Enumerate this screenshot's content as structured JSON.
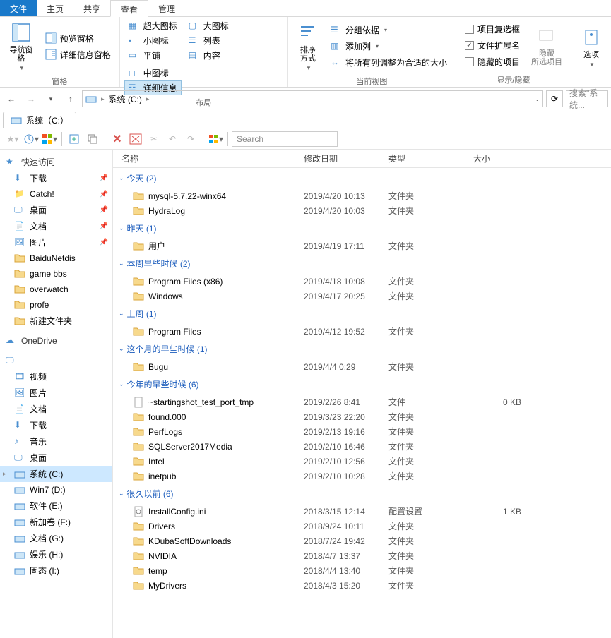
{
  "ribbon": {
    "tabs": [
      "文件",
      "主页",
      "共享",
      "查看",
      "管理"
    ],
    "groups": {
      "panes": {
        "nav": "导航窗格",
        "preview": "预览窗格",
        "details": "详细信息窗格",
        "label": "窗格"
      },
      "layout": {
        "items": [
          "超大图标",
          "大图标",
          "中图标",
          "小图标",
          "列表",
          "详细信息",
          "平铺",
          "内容"
        ],
        "label": "布局"
      },
      "view": {
        "sort": "排序方式",
        "group": "分组依据",
        "addcol": "添加列",
        "fitcols": "将所有列调整为合适的大小",
        "label": "当前视图"
      },
      "showhide": {
        "checkboxes": "项目复选框",
        "ext": "文件扩展名",
        "hidden": "隐藏的项目",
        "hideitems": "隐藏\n所选项目",
        "label": "显示/隐藏"
      },
      "options": "选项"
    }
  },
  "address": {
    "crumb": "系统 (C:)",
    "search_placeholder": "搜索\"系统..."
  },
  "doctab": "系统（C:）",
  "toolbar_search": "Search",
  "columns": {
    "name": "名称",
    "date": "修改日期",
    "type": "类型",
    "size": "大小"
  },
  "nav": {
    "quick": {
      "label": "快速访问",
      "items": [
        "下载",
        "Catch!",
        "桌面",
        "文档",
        "图片"
      ]
    },
    "loose": [
      "BaiduNetdis",
      "game bbs",
      "overwatch",
      "profe",
      "新建文件夹"
    ],
    "onedrive": "OneDrive",
    "thispc": {
      "items": [
        "视频",
        "图片",
        "文档",
        "下载",
        "音乐",
        "桌面"
      ]
    },
    "drives": [
      "系统 (C:)",
      "Win7 (D:)",
      "软件 (E:)",
      "新加卷 (F:)",
      "文档 (G:)",
      "娱乐 (H:)",
      "固态 (I:)"
    ]
  },
  "groups": [
    {
      "label": "今天 (2)",
      "items": [
        {
          "icon": "folder",
          "name": "mysql-5.7.22-winx64",
          "date": "2019/4/20 10:13",
          "type": "文件夹",
          "size": ""
        },
        {
          "icon": "folder",
          "name": "HydraLog",
          "date": "2019/4/20 10:03",
          "type": "文件夹",
          "size": ""
        }
      ]
    },
    {
      "label": "昨天 (1)",
      "items": [
        {
          "icon": "folder",
          "name": "用户",
          "date": "2019/4/19 17:11",
          "type": "文件夹",
          "size": ""
        }
      ]
    },
    {
      "label": "本周早些时候 (2)",
      "items": [
        {
          "icon": "folder",
          "name": "Program Files (x86)",
          "date": "2019/4/18 10:08",
          "type": "文件夹",
          "size": ""
        },
        {
          "icon": "folder",
          "name": "Windows",
          "date": "2019/4/17 20:25",
          "type": "文件夹",
          "size": ""
        }
      ]
    },
    {
      "label": "上周 (1)",
      "items": [
        {
          "icon": "folder",
          "name": "Program Files",
          "date": "2019/4/12 19:52",
          "type": "文件夹",
          "size": ""
        }
      ]
    },
    {
      "label": "这个月的早些时候 (1)",
      "items": [
        {
          "icon": "folder",
          "name": "Bugu",
          "date": "2019/4/4 0:29",
          "type": "文件夹",
          "size": ""
        }
      ]
    },
    {
      "label": "今年的早些时候 (6)",
      "items": [
        {
          "icon": "file",
          "name": "~startingshot_test_port_tmp",
          "date": "2019/2/26 8:41",
          "type": "文件",
          "size": "0 KB"
        },
        {
          "icon": "folder",
          "name": "found.000",
          "date": "2019/3/23 22:20",
          "type": "文件夹",
          "size": ""
        },
        {
          "icon": "folder",
          "name": "PerfLogs",
          "date": "2019/2/13 19:16",
          "type": "文件夹",
          "size": ""
        },
        {
          "icon": "folder",
          "name": "SQLServer2017Media",
          "date": "2019/2/10 16:46",
          "type": "文件夹",
          "size": ""
        },
        {
          "icon": "folder",
          "name": "Intel",
          "date": "2019/2/10 12:56",
          "type": "文件夹",
          "size": ""
        },
        {
          "icon": "folder",
          "name": "inetpub",
          "date": "2019/2/10 10:28",
          "type": "文件夹",
          "size": ""
        }
      ]
    },
    {
      "label": "很久以前 (6)",
      "items": [
        {
          "icon": "ini",
          "name": "InstallConfig.ini",
          "date": "2018/3/15 12:14",
          "type": "配置设置",
          "size": "1 KB"
        },
        {
          "icon": "folder",
          "name": "Drivers",
          "date": "2018/9/24 10:11",
          "type": "文件夹",
          "size": ""
        },
        {
          "icon": "folder",
          "name": "KDubaSoftDownloads",
          "date": "2018/7/24 19:42",
          "type": "文件夹",
          "size": ""
        },
        {
          "icon": "folder",
          "name": "NVIDIA",
          "date": "2018/4/7 13:37",
          "type": "文件夹",
          "size": ""
        },
        {
          "icon": "folder",
          "name": "temp",
          "date": "2018/4/4 13:40",
          "type": "文件夹",
          "size": ""
        },
        {
          "icon": "folder",
          "name": "MyDrivers",
          "date": "2018/4/3 15:20",
          "type": "文件夹",
          "size": ""
        }
      ]
    }
  ]
}
